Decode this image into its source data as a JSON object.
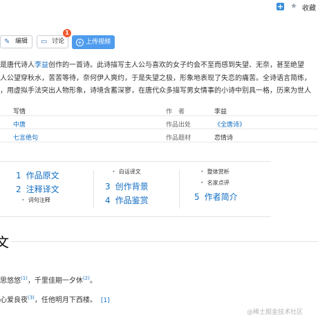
{
  "topbar": {
    "collect_label": "收藏",
    "add_icon": "plus-icon",
    "collect_icon": "star-icon"
  },
  "toolbar": {
    "edit_label": "编辑",
    "discuss_label": "讨论",
    "discuss_badge": "1",
    "upload_label": "上传视频"
  },
  "intro": {
    "line1_a": "是唐代诗人",
    "line1_link": "李益",
    "line1_b": "创作的一首诗。此诗描写主人公与喜欢的女子约会不至而感到失望、无奈，甚至绝望",
    "line2": "人公望穿秋水，苦苦等待，奈何伊人爽约，于是失望之极，形象地表现了失恋的痛苦。全诗语言简练，",
    "line3": "，用虚拟手法突出人物形象，诗境含蓄深寥，在唐代众多描写男女情事的小诗中别具一格，历来为世人"
  },
  "info": {
    "rows": [
      {
        "v1": "写情",
        "k2": "作　者",
        "v2": "李益"
      },
      {
        "v1": "中唐",
        "k2": "作品出处",
        "v2": "《全唐诗》"
      },
      {
        "v1": "七言绝句",
        "k2": "作品题材",
        "v2": "恋情诗"
      }
    ]
  },
  "catalog": {
    "items": [
      {
        "num": "1",
        "label": "作品原文"
      },
      {
        "num": "2",
        "label": "注释译文"
      },
      {
        "num": "3",
        "label": "创作背景"
      },
      {
        "num": "4",
        "label": "作品鉴赏"
      },
      {
        "num": "5",
        "label": "作者简介"
      }
    ],
    "subs": [
      "词句注释",
      "白话译文",
      "整体赏析",
      "名家点评"
    ]
  },
  "section": {
    "title_char": "文"
  },
  "verses": {
    "line1_text": "思悠悠",
    "line1_sup1": "(1)",
    "line1_mid": "，千里佳期一夕休",
    "line1_sup2": "(2)",
    "line1_end": "。",
    "line2_text": "心爱良夜",
    "line2_sup": "(3)",
    "line2_end": "，任他明月下西楼。",
    "line2_ref": "[1]"
  },
  "watermark": "@稀土掘金技术社区"
}
